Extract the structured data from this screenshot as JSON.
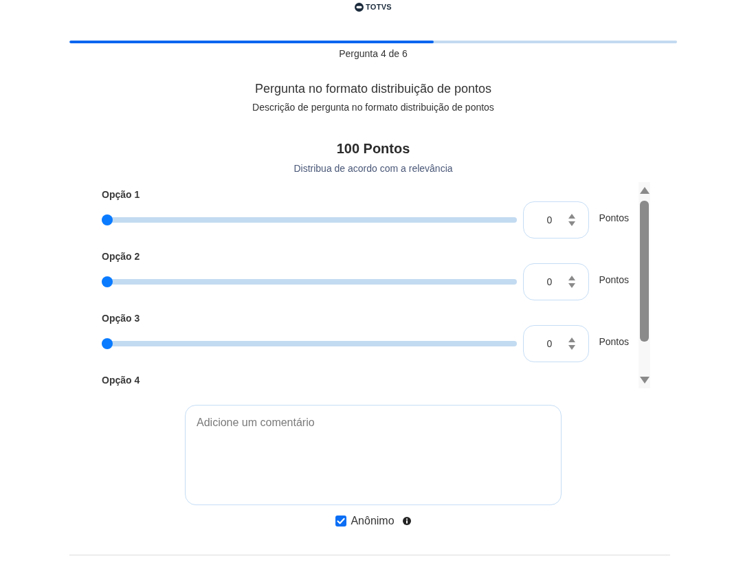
{
  "header": {
    "logo_text": "TOTVS"
  },
  "progress": {
    "level": 0.6,
    "label": "Pergunta 4 de 6"
  },
  "question": {
    "title": "Pergunta no formato distribuição de pontos",
    "description": "Descrição de pergunta no formato distribuição de pontos"
  },
  "points": {
    "total": "100 Pontos",
    "hint": "Distribua de acordo com a relevância"
  },
  "options": [
    {
      "label": "Opção 1",
      "level": 0,
      "value": "0",
      "unit": "Pontos"
    },
    {
      "label": "Opção 2",
      "level": 0,
      "value": "0",
      "unit": "Pontos"
    },
    {
      "label": "Opção 3",
      "level": 0,
      "value": "0",
      "unit": "Pontos"
    },
    {
      "label": "Opção 4"
    }
  ],
  "comment": {
    "placeholder": "Adicione um comentário"
  },
  "anonymous": {
    "label": "Anônimo",
    "checked": true
  }
}
